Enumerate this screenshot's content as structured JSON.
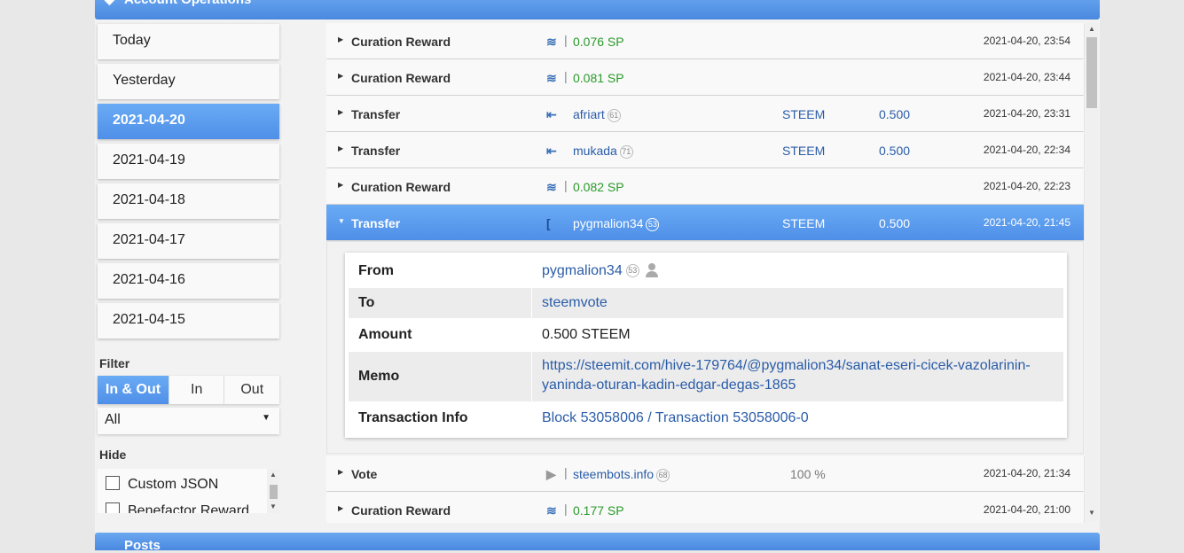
{
  "header": {
    "title": "Account Operations",
    "icon": "chevron-down-icon"
  },
  "footer": {
    "title": "Posts"
  },
  "sidebar": {
    "days": [
      "Today",
      "Yesterday",
      "2021-04-20",
      "2021-04-19",
      "2021-04-18",
      "2021-04-17",
      "2021-04-16",
      "2021-04-15"
    ],
    "active_day": "2021-04-20",
    "filter_label": "Filter",
    "filter_options": [
      "In & Out",
      "In",
      "Out"
    ],
    "filter_selected": "In & Out",
    "type_select": "All",
    "hide_label": "Hide",
    "hide_options": [
      "Custom JSON",
      "Benefactor Reward"
    ]
  },
  "operations": [
    {
      "type": "Curation Reward",
      "icon": "steem-power-icon",
      "value": "0.076 SP",
      "date": "2021-04-20, 23:54"
    },
    {
      "type": "Curation Reward",
      "icon": "steem-power-icon",
      "value": "0.081 SP",
      "date": "2021-04-20, 23:44"
    },
    {
      "type": "Transfer",
      "icon": "transfer-in-icon",
      "account": "afriart",
      "rep": "61",
      "asset": "STEEM",
      "amount": "0.500",
      "date": "2021-04-20, 23:31"
    },
    {
      "type": "Transfer",
      "icon": "transfer-in-icon",
      "account": "mukada",
      "rep": "71",
      "asset": "STEEM",
      "amount": "0.500",
      "date": "2021-04-20, 22:34"
    },
    {
      "type": "Curation Reward",
      "icon": "steem-power-icon",
      "value": "0.082 SP",
      "date": "2021-04-20, 22:23"
    },
    {
      "type": "Transfer",
      "icon": "transfer-out-icon",
      "account": "pygmalion34",
      "rep": "53",
      "asset": "STEEM",
      "amount": "0.500",
      "date": "2021-04-20, 21:45"
    },
    {
      "type": "Vote",
      "icon": "vote-icon",
      "account": "steembots.info",
      "rep": "68",
      "percent": "100 %",
      "date": "2021-04-20, 21:34"
    },
    {
      "type": "Curation Reward",
      "icon": "steem-power-icon",
      "value": "0.177 SP",
      "date": "2021-04-20, 21:00"
    }
  ],
  "detail": {
    "from_label": "From",
    "from": "pygmalion34",
    "from_rep": "53",
    "to_label": "To",
    "to": "steemvote",
    "amount_label": "Amount",
    "amount": "0.500 STEEM",
    "memo_label": "Memo",
    "memo_line1": "https://steemit.com/hive-179764/@pygmalion34/sanat-eseri-cicek-vazolarinin-",
    "memo_line2": "yaninda-oturan-kadin-edgar-degas-1865",
    "tx_label": "Transaction Info",
    "tx": "Block 53058006 / Transaction 53058006-0"
  },
  "colors": {
    "accent": "#5b9bec",
    "green": "#2a9a2a",
    "link": "#2a5ca8"
  }
}
